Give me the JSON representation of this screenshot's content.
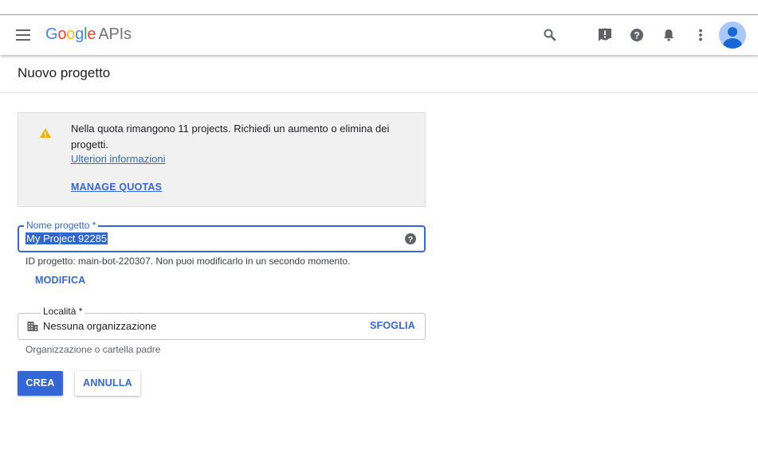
{
  "header": {
    "logo_letters": [
      "G",
      "o",
      "o",
      "g",
      "l",
      "e"
    ],
    "logo_product": "APIs",
    "icons": [
      "menu-icon",
      "search-icon",
      "feedback-icon",
      "help-icon",
      "notifications-icon",
      "more-vert-icon",
      "account-avatar"
    ]
  },
  "page": {
    "title": "Nuovo progetto"
  },
  "quota": {
    "message": "Nella quota rimangono 11 projects. Richiedi un aumento o elimina dei progetti.",
    "learn_more": "Ulteriori informazioni",
    "manage": "MANAGE QUOTAS"
  },
  "project_name": {
    "label": "Nome progetto *",
    "value": "My Project 92285",
    "id_hint": "ID progetto: main-bot-220307. Non puoi modificarlo in un secondo momento.",
    "modify": "MODIFICA"
  },
  "location": {
    "label": "Località *",
    "value": "Nessuna organizzazione",
    "browse": "SFOGLIA",
    "hint": "Organizzazione o cartella padre"
  },
  "actions": {
    "create": "CREA",
    "cancel": "ANNULLA"
  },
  "colors": {
    "primary": "#3367d6",
    "warning": "#f9ab00",
    "logo": [
      "#4285f4",
      "#ea4335",
      "#fbbc05",
      "#4285f4",
      "#34a853",
      "#ea4335"
    ]
  }
}
